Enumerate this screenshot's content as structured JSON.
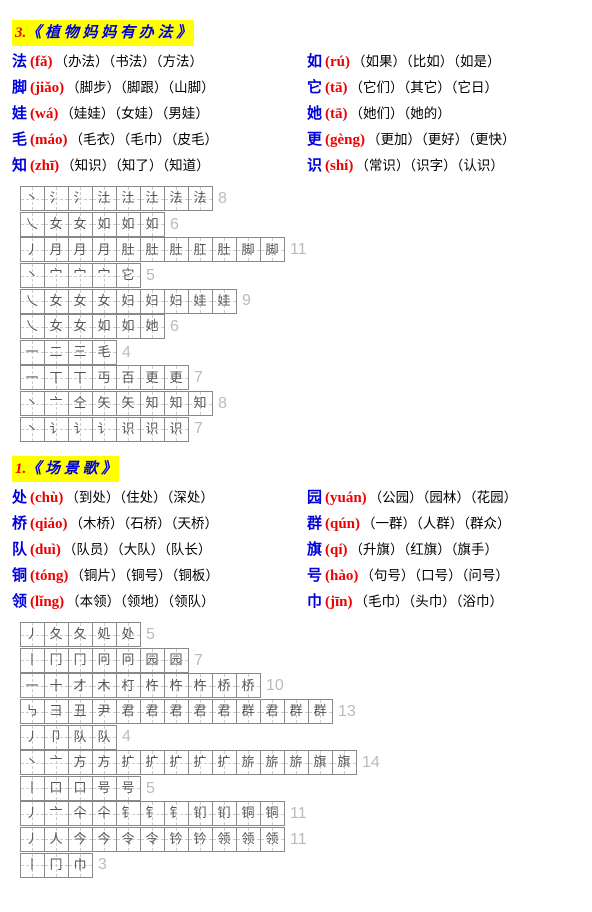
{
  "lessons": [
    {
      "num": "3.",
      "title": "《 植 物 妈 妈 有 办 法 》",
      "left": [
        {
          "hanzi": "法",
          "pinyin": "(fǎ)",
          "words": "（办法）（书法）（方法）"
        },
        {
          "hanzi": "脚",
          "pinyin": "(jiǎo)",
          "words": "（脚步）（脚跟）（山脚）"
        },
        {
          "hanzi": "娃",
          "pinyin": "(wá)",
          "words": "（娃娃）（女娃）（男娃）"
        },
        {
          "hanzi": "毛",
          "pinyin": "(máo)",
          "words": "（毛衣）（毛巾）（皮毛）"
        },
        {
          "hanzi": "知",
          "pinyin": "(zhī)",
          "words": "（知识）（知了）（知道）"
        }
      ],
      "right": [
        {
          "hanzi": "如",
          "pinyin": "(rú)",
          "words": "（如果）（比如）（如是）"
        },
        {
          "hanzi": "它",
          "pinyin": "(tā)",
          "words": "（它们）（其它）（它日）"
        },
        {
          "hanzi": "她",
          "pinyin": "(tā)",
          "words": "（她们）（她的）"
        },
        {
          "hanzi": "更",
          "pinyin": "(gèng)",
          "words": "（更加）（更好）（更快）"
        },
        {
          "hanzi": "识",
          "pinyin": "(shí)",
          "words": "（常识）（识字）（认识）"
        }
      ],
      "strokes": [
        {
          "cells": [
            "丶",
            "氵",
            "氵",
            "汢",
            "汢",
            "汢",
            "法",
            "法"
          ],
          "count": 8
        },
        {
          "cells": [
            "乀",
            "女",
            "女",
            "如",
            "如",
            "如"
          ],
          "count": 6
        },
        {
          "cells": [
            "丿",
            "月",
            "月",
            "月",
            "肚",
            "肚",
            "肚",
            "肛",
            "肚",
            "脚",
            "脚"
          ],
          "count": 11
        },
        {
          "cells": [
            "丶",
            "宀",
            "宀",
            "宀",
            "它"
          ],
          "count": 5
        },
        {
          "cells": [
            "乀",
            "女",
            "女",
            "女",
            "妇",
            "妇",
            "妇",
            "娃",
            "娃"
          ],
          "count": 9
        },
        {
          "cells": [
            "乀",
            "女",
            "女",
            "如",
            "如",
            "她"
          ],
          "count": 6
        },
        {
          "cells": [
            "一",
            "二",
            "三",
            "毛"
          ],
          "count": 4
        },
        {
          "cells": [
            "一",
            "丅",
            "丅",
            "丏",
            "百",
            "更",
            "更"
          ],
          "count": 7
        },
        {
          "cells": [
            "丶",
            "亠",
            "仝",
            "矢",
            "矢",
            "知",
            "知",
            "知"
          ],
          "count": 8
        },
        {
          "cells": [
            "丶",
            "讠",
            "讠",
            "讠",
            "识",
            "识",
            "识"
          ],
          "count": 7
        }
      ]
    },
    {
      "num": "1.",
      "title": "《 场 景 歌 》",
      "left": [
        {
          "hanzi": "处",
          "pinyin": "(chù)",
          "words": "（到处）（住处）（深处）"
        },
        {
          "hanzi": "桥",
          "pinyin": "(qiáo)",
          "words": "（木桥）（石桥）（天桥）"
        },
        {
          "hanzi": "队",
          "pinyin": "(duì)",
          "words": "（队员）（大队）（队长）"
        },
        {
          "hanzi": "铜",
          "pinyin": "(tóng)",
          "words": "（铜片）（铜号）（铜板）"
        },
        {
          "hanzi": "领",
          "pinyin": "(lǐng)",
          "words": "（本领）（领地）（领队）"
        }
      ],
      "right": [
        {
          "hanzi": "园",
          "pinyin": "(yuán)",
          "words": "（公园）（园林）（花园）"
        },
        {
          "hanzi": "群",
          "pinyin": "(qún)",
          "words": "（一群）（人群）（群众）"
        },
        {
          "hanzi": "旗",
          "pinyin": "(qí)",
          "words": "（升旗）（红旗）（旗手）"
        },
        {
          "hanzi": "号",
          "pinyin": "(hào)",
          "words": "（句号）（口号）（问号）"
        },
        {
          "hanzi": "巾",
          "pinyin": "(jīn)",
          "words": "（毛巾）（头巾）（浴巾）"
        }
      ],
      "strokes": [
        {
          "cells": [
            "丿",
            "夂",
            "夂",
            "処",
            "处"
          ],
          "count": 5
        },
        {
          "cells": [
            "丨",
            "冂",
            "冂",
            "冋",
            "冋",
            "园",
            "园"
          ],
          "count": 7
        },
        {
          "cells": [
            "一",
            "十",
            "才",
            "木",
            "朾",
            "杵",
            "杵",
            "杵",
            "桥",
            "桥"
          ],
          "count": 10
        },
        {
          "cells": [
            "㇉",
            "⺕",
            "丑",
            "尹",
            "君",
            "君",
            "君",
            "君",
            "君",
            "群",
            "君",
            "群",
            "群"
          ],
          "count": 13
        },
        {
          "cells": [
            "丿",
            "卩",
            "队",
            "队"
          ],
          "count": 4
        },
        {
          "cells": [
            "丶",
            "亠",
            "方",
            "方",
            "扩",
            "扩",
            "扩",
            "扩",
            "扩",
            "旂",
            "旂",
            "旂",
            "旗",
            "旗"
          ],
          "count": 14
        },
        {
          "cells": [
            "丨",
            "口",
            "口",
            "号",
            "号"
          ],
          "count": 5
        },
        {
          "cells": [
            "丿",
            "亠",
            "仐",
            "仐",
            "钅",
            "钅",
            "钅",
            "钔",
            "钔",
            "铜",
            "铜"
          ],
          "count": 11
        },
        {
          "cells": [
            "丿",
            "人",
            "今",
            "今",
            "令",
            "令",
            "钤",
            "钤",
            "领",
            "领",
            "领"
          ],
          "count": 11
        },
        {
          "cells": [
            "丨",
            "冂",
            "巾"
          ],
          "count": 3
        }
      ]
    }
  ]
}
